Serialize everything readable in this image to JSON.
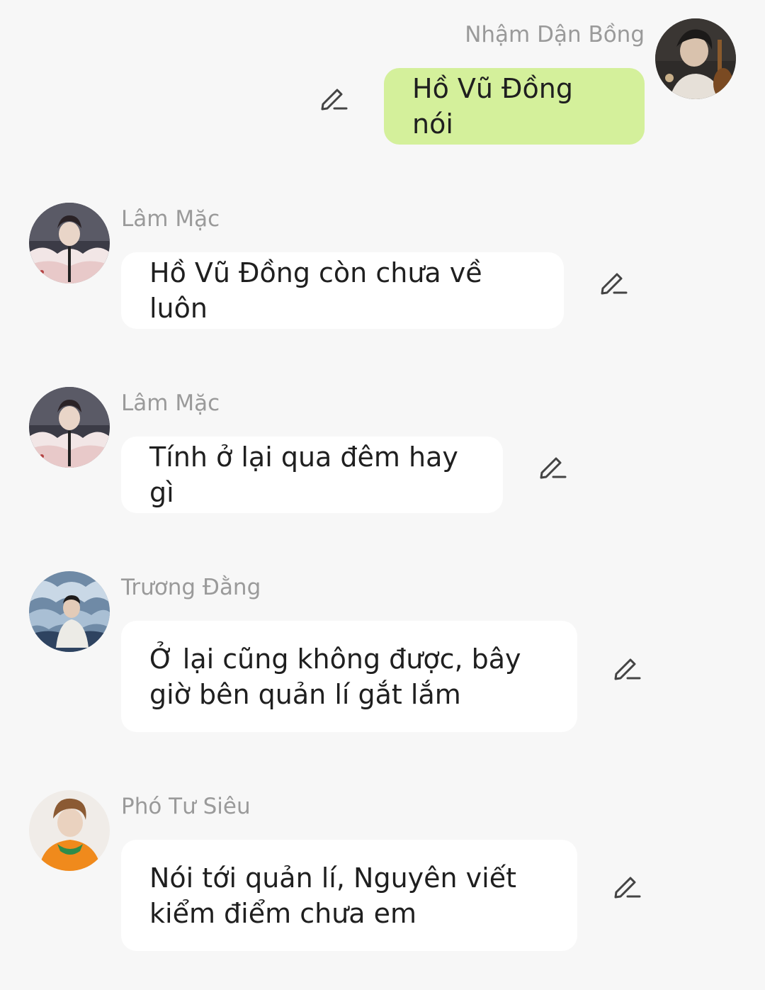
{
  "messages": [
    {
      "sender": "Nhậm Dận Bồng",
      "text": "Hồ Vũ Đồng nói",
      "outgoing": true,
      "avatar_icon": "avatar-cellist-icon",
      "bubble_color": "#d4f09b"
    },
    {
      "sender": "Lâm Mặc",
      "text": "Hồ Vũ Đồng còn chưa về luôn",
      "outgoing": false,
      "avatar_icon": "avatar-singer-icon"
    },
    {
      "sender": "Lâm Mặc",
      "text": "Tính ở lại qua đêm hay gì",
      "outgoing": false,
      "avatar_icon": "avatar-singer-icon"
    },
    {
      "sender": "Trương Đằng",
      "text": "Ở lại cũng không được, bây giờ bên quản lí gắt lắm",
      "outgoing": false,
      "avatar_icon": "avatar-waves-icon"
    },
    {
      "sender": "Phó Tư Siêu",
      "text": "Nói tới quản lí, Nguyên viết kiểm điểm chưa em",
      "outgoing": false,
      "avatar_icon": "avatar-orange-sweater-icon"
    }
  ],
  "edit_icon": "pencil-edit-icon",
  "colors": {
    "background": "#f7f7f7",
    "incoming_bubble": "#ffffff",
    "outgoing_bubble": "#d4f09b",
    "sender_name": "#9a9a9a",
    "message_text": "#1f1f1f"
  }
}
